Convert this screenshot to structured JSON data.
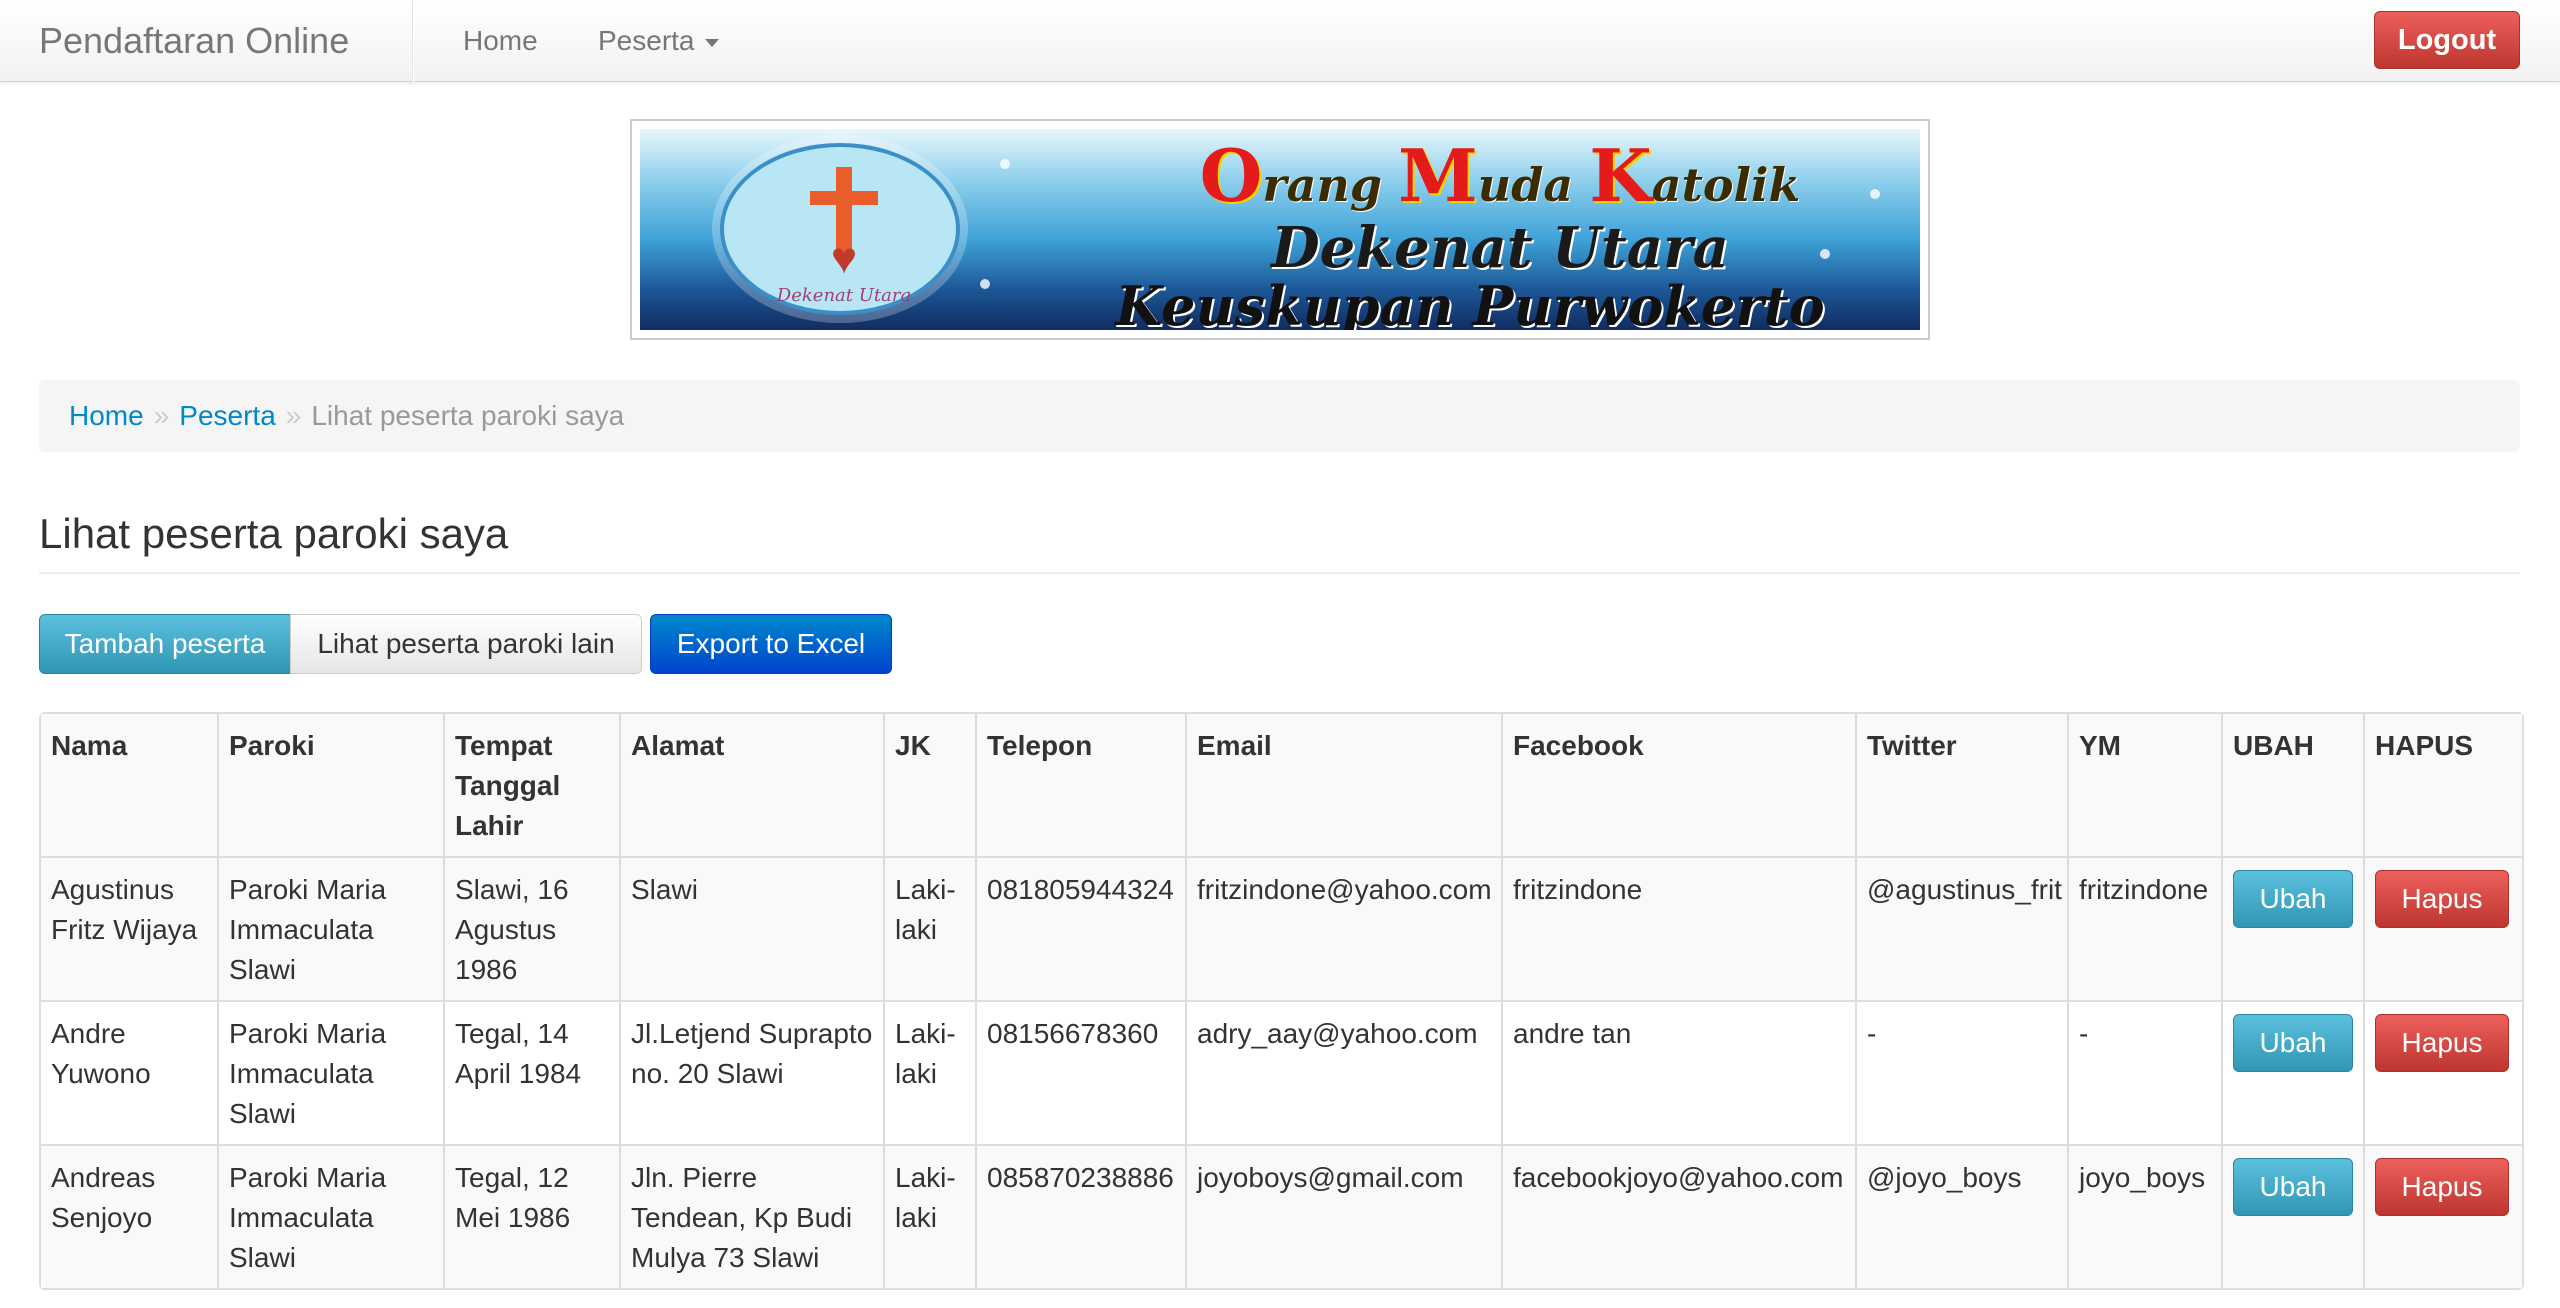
{
  "navbar": {
    "brand": "Pendaftaran Online",
    "home": "Home",
    "peserta": "Peserta",
    "logout": "Logout"
  },
  "banner": {
    "line1_parts": [
      {
        "big": "O",
        "rest": "rang "
      },
      {
        "big": "M",
        "rest": "uda "
      },
      {
        "big": "K",
        "rest": "atolik"
      }
    ],
    "line2": "Dekenat Utara",
    "line3": "Keuskupan Purwokerto",
    "logo_text": "Dekenat Utara"
  },
  "breadcrumb": {
    "home": "Home",
    "sep": "»",
    "peserta": "Peserta",
    "current": "Lihat peserta paroki saya"
  },
  "page": {
    "title": "Lihat peserta paroki saya"
  },
  "actions": {
    "tambah": "Tambah peserta",
    "lihat_lain": "Lihat peserta paroki lain",
    "export": "Export to Excel"
  },
  "table": {
    "headers": [
      "Nama",
      "Paroki",
      "Tempat Tanggal Lahir",
      "Alamat",
      "JK",
      "Telepon",
      "Email",
      "Facebook",
      "Twitter",
      "YM",
      "UBAH",
      "HAPUS"
    ],
    "rows": [
      {
        "nama": "Agustinus Fritz Wijaya",
        "paroki": "Paroki Maria Immaculata Slawi",
        "ttl": "Slawi, 16 Agustus 1986",
        "alamat": "Slawi",
        "jk": "Laki-laki",
        "telepon": "081805944324",
        "email": "fritzindone@yahoo.com",
        "facebook": "fritzindone",
        "twitter": "@agustinus_frit",
        "ym": "fritzindone",
        "ubah": "Ubah",
        "hapus": "Hapus"
      },
      {
        "nama": "Andre Yuwono",
        "paroki": "Paroki Maria Immaculata Slawi",
        "ttl": "Tegal, 14 April 1984",
        "alamat": "Jl.Letjend Suprapto no. 20 Slawi",
        "jk": "Laki-laki",
        "telepon": "08156678360",
        "email": "adry_aay@yahoo.com",
        "facebook": "andre tan",
        "twitter": "-",
        "ym": "-",
        "ubah": "Ubah",
        "hapus": "Hapus"
      },
      {
        "nama": "Andreas Senjoyo",
        "paroki": "Paroki Maria Immaculata Slawi",
        "ttl": "Tegal, 12 Mei 1986",
        "alamat": "Jln. Pierre Tendean, Kp Budi Mulya 73 Slawi",
        "jk": "Laki-laki",
        "telepon": "085870238886",
        "email": "joyoboys@gmail.com",
        "facebook": "facebookjoyo@yahoo.com",
        "twitter": "@joyo_boys",
        "ym": "joyo_boys",
        "ubah": "Ubah",
        "hapus": "Hapus"
      }
    ]
  }
}
